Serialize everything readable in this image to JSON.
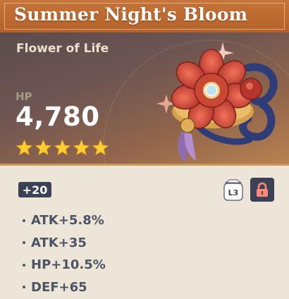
{
  "artifact": {
    "name": "Summer Night's Bloom",
    "slot": "Flower of Life",
    "main_stat": {
      "label": "HP",
      "value": "4,780"
    },
    "rarity": 5,
    "level": "+20",
    "lock_level_label": "L3",
    "locked": true,
    "substats": [
      {
        "text": "ATK+5.8%"
      },
      {
        "text": "ATK+35"
      },
      {
        "text": "HP+10.5%"
      },
      {
        "text": "DEF+65"
      }
    ]
  },
  "colors": {
    "title_bar": "#bc6a30",
    "star": "#ffcc32",
    "badge_bg": "#3b4255",
    "lock_icon": "#ff8a7a",
    "body_bg": "#ece5d8",
    "substat_text": "#4d5466"
  },
  "icons": {
    "star": "star-icon",
    "lock": "lock-icon",
    "level_tag": "lock-level-tag-icon"
  }
}
